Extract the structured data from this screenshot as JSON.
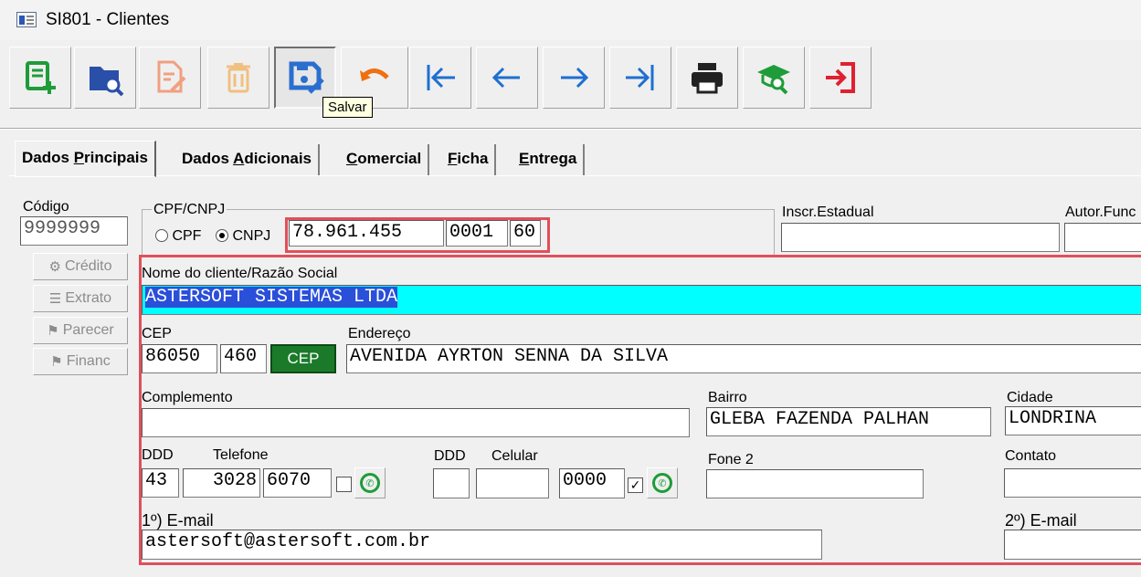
{
  "window": {
    "title": "SI801 - Clientes"
  },
  "toolbar": {
    "buttons": [
      {
        "name": "new-record-icon",
        "color": "#1e9c3a"
      },
      {
        "name": "search-folder-icon",
        "color": "#2a4fa8"
      },
      {
        "name": "edit-document-icon",
        "color": "#f0a080"
      },
      {
        "name": "trash-icon",
        "color": "#f0c080"
      },
      {
        "name": "save-icon",
        "color": "#2a6fd0"
      },
      {
        "name": "undo-icon",
        "color": "#f07010"
      },
      {
        "name": "first-record-icon",
        "color": "#1e6fd0"
      },
      {
        "name": "previous-record-icon",
        "color": "#1e6fd0"
      },
      {
        "name": "next-record-icon",
        "color": "#1e6fd0"
      },
      {
        "name": "last-record-icon",
        "color": "#1e6fd0"
      },
      {
        "name": "printer-icon",
        "color": "#222222"
      },
      {
        "name": "search-hat-icon",
        "color": "#1e9c3a"
      },
      {
        "name": "exit-icon",
        "color": "#e02030"
      }
    ],
    "tooltip": "Salvar"
  },
  "tabs": [
    {
      "pre": "Dados ",
      "u": "P",
      "post": "rincipais"
    },
    {
      "pre": "Dados ",
      "u": "A",
      "post": "dicionais"
    },
    {
      "pre": "",
      "u": "C",
      "post": "omercial"
    },
    {
      "pre": "",
      "u": "F",
      "post": "icha"
    },
    {
      "pre": "",
      "u": "E",
      "post": "ntrega"
    }
  ],
  "form": {
    "codigo_label": "Código",
    "codigo": "9999999",
    "side_buttons": [
      "Crédito",
      "Extrato",
      "Parecer",
      "Financ"
    ],
    "cpfcnpj_label": "CPF/CNPJ",
    "cpf_label": "CPF",
    "cnpj_label": "CNPJ",
    "cnpj_base": "78.961.455",
    "cnpj_filial": "0001",
    "cnpj_dv": "60",
    "inscr_label": "Inscr.Estadual",
    "inscr_value": "",
    "autor_label": "Autor.Func",
    "nome_label": "Nome do cliente/Razão Social",
    "nome": "ASTERSOFT SISTEMAS LTDA",
    "cep_label": "CEP",
    "cep1": "86050",
    "cep2": "460",
    "cep_button": "CEP",
    "endereco_label": "Endereço",
    "endereco": "AVENIDA AYRTON SENNA DA SILVA",
    "complemento_label": "Complemento",
    "complemento": "",
    "bairro_label": "Bairro",
    "bairro": "GLEBA FAZENDA PALHAN",
    "cidade_label": "Cidade",
    "cidade": "LONDRINA",
    "ddd_label": "DDD",
    "telefone_label": "Telefone",
    "ddd": "43",
    "tel1": "3028",
    "tel2": "6070",
    "ddd2_label": "DDD",
    "celular_label": "Celular",
    "ddd2": "",
    "cel1": "",
    "cel2": "0000",
    "fone2_label": "Fone 2",
    "contato_label": "Contato",
    "email1_label": "1º) E-mail",
    "email1": "astersoft@astersoft.com.br",
    "email2_label": "2º) E-mail"
  }
}
